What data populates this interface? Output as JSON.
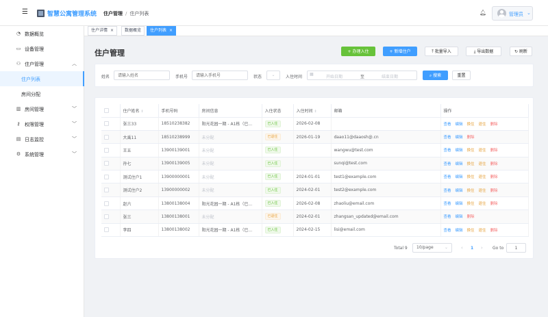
{
  "header": {
    "app_title": "智慧公寓管理系统",
    "breadcrumb": [
      "住户管理",
      "住户列表"
    ],
    "breadcrumb_sep": "/",
    "user_name": "管理员"
  },
  "sidebar": {
    "items": [
      {
        "label": "数据概览",
        "icon": "dashboard-icon"
      },
      {
        "label": "设备管理",
        "icon": "monitor-icon"
      },
      {
        "label": "住户管理",
        "icon": "user-icon",
        "expanded": true
      },
      {
        "label": "住户列表",
        "sub": true,
        "active": true
      },
      {
        "label": "房间分配",
        "sub": true
      },
      {
        "label": "房间管理",
        "icon": "building-icon"
      },
      {
        "label": "权限管理",
        "icon": "key-icon"
      },
      {
        "label": "日志监控",
        "icon": "document-icon"
      },
      {
        "label": "系统管理",
        "icon": "gear-icon"
      }
    ]
  },
  "tabs": [
    {
      "label": "住户详情",
      "close": "×"
    },
    {
      "label": "数据概览",
      "close": ""
    },
    {
      "label": "住户列表",
      "close": "×",
      "active": true
    }
  ],
  "page": {
    "title": "住户管理",
    "buttons": {
      "checkin": "+ 办理入住",
      "add": "+ 新增住户",
      "import": "批量导入",
      "export": "导出数据",
      "refresh": "刷新"
    }
  },
  "filters": {
    "name_label": "姓名",
    "name_placeholder": "请输入姓名",
    "phone_label": "手机号",
    "phone_placeholder": "请输入手机号",
    "status_label": "状态",
    "date_label": "入住时间",
    "date_start_placeholder": "开始日期",
    "date_sep": "至",
    "date_end_placeholder": "结束日期",
    "search": "搜索",
    "reset": "重置"
  },
  "table": {
    "columns": [
      "住户姓名",
      "手机号码",
      "房间信息",
      "入住状态",
      "入住时间",
      "邮箱",
      "操作"
    ],
    "action_labels": {
      "view": "查看",
      "edit": "编辑",
      "swap": "换住",
      "checkout": "退住",
      "delete": "删除"
    },
    "rows": [
      {
        "name": "张三33",
        "phone": "18510238382",
        "room": "阳光花园一期 - A1栋（已...",
        "status": "已入住",
        "date": "2026-02-08",
        "email": "",
        "actions": [
          "view",
          "edit",
          "swap",
          "checkout",
          "delete"
        ]
      },
      {
        "name": "大禹11",
        "phone": "18510238999",
        "room": "未分配",
        "status": "已退住",
        "date": "2026-01-19",
        "email": "daao11@daaosh@.cn",
        "actions": [
          "view",
          "edit",
          "delete"
        ]
      },
      {
        "name": "王五",
        "phone": "13900139001",
        "room": "未分配",
        "status": "已入住",
        "date": "",
        "email": "wangwu@test.com",
        "actions": [
          "view",
          "edit",
          "swap",
          "checkout",
          "delete"
        ]
      },
      {
        "name": "孙七",
        "phone": "13900139005",
        "room": "未分配",
        "status": "已入住",
        "date": "",
        "email": "sunqi@test.com",
        "actions": [
          "view",
          "edit",
          "swap",
          "checkout",
          "delete"
        ]
      },
      {
        "name": "测试住户1",
        "phone": "13900000001",
        "room": "未分配",
        "status": "已入住",
        "date": "2024-01-01",
        "email": "test1@example.com",
        "actions": [
          "view",
          "edit",
          "swap",
          "checkout",
          "delete"
        ]
      },
      {
        "name": "测试住户2",
        "phone": "13900000002",
        "room": "未分配",
        "status": "已入住",
        "date": "2024-02-01",
        "email": "test2@example.com",
        "actions": [
          "view",
          "edit",
          "swap",
          "checkout",
          "delete"
        ]
      },
      {
        "name": "赵六",
        "phone": "13800138004",
        "room": "阳光花园一期 - A1栋（已...",
        "status": "已入住",
        "date": "2026-02-08",
        "email": "zhaoliu@email.com",
        "actions": [
          "view",
          "edit",
          "swap",
          "checkout",
          "delete"
        ]
      },
      {
        "name": "张三",
        "phone": "13800138001",
        "room": "未分配",
        "status": "已退住",
        "date": "2024-02-01",
        "email": "zhangsan_updated@email.com",
        "actions": [
          "view",
          "edit",
          "delete"
        ]
      },
      {
        "name": "李四",
        "phone": "13800138002",
        "room": "阳光花园一期 - A1栋（已...",
        "status": "已入住",
        "date": "2024-02-15",
        "email": "lisi@email.com",
        "actions": [
          "view",
          "edit",
          "swap",
          "checkout",
          "delete"
        ]
      }
    ]
  },
  "pagination": {
    "total": "Total 9",
    "page_size": "10/page",
    "current": "1",
    "goto_label": "Go to",
    "goto_value": "1"
  },
  "colors": {
    "primary": "#409eff",
    "success": "#67c23a",
    "warning": "#e6a23c",
    "danger": "#f56c6c"
  }
}
